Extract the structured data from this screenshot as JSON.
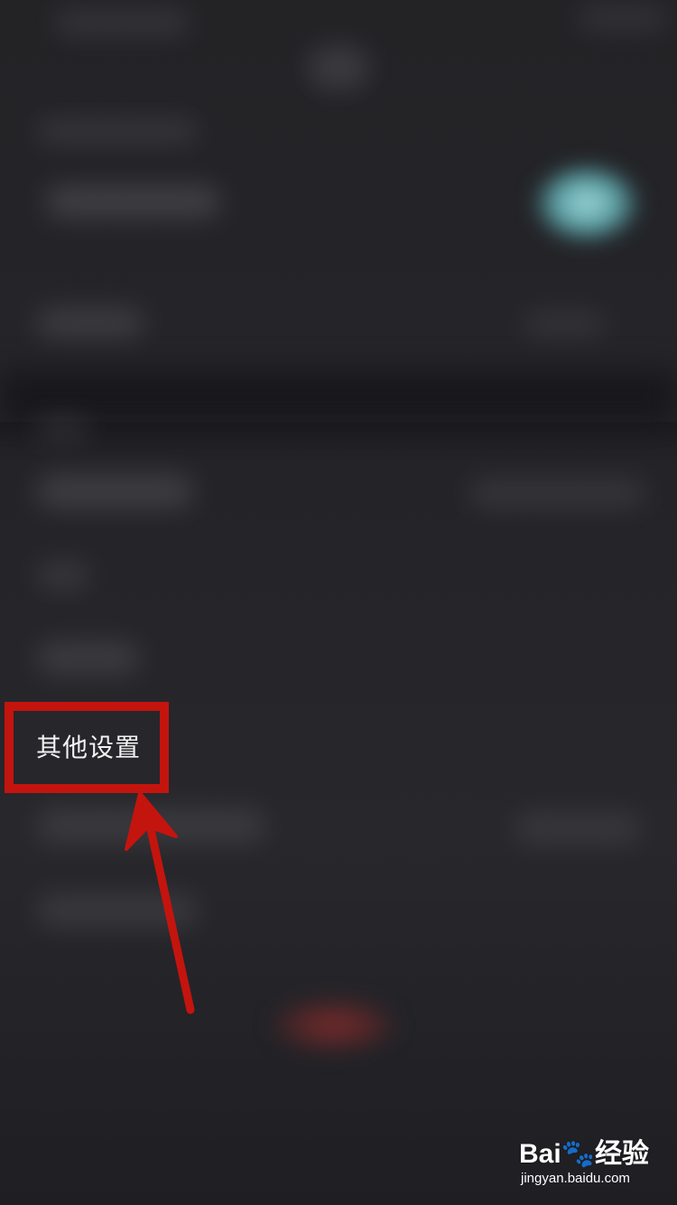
{
  "settings_list": {
    "highlighted_item_label": "其他设置"
  },
  "annotation": {
    "box_color": "#c4140e",
    "arrow_color": "#c4140e"
  },
  "watermark": {
    "logo_text": "Bai🐾经验",
    "url_text": "jingyan.baidu.com"
  },
  "colors": {
    "background": "#232326",
    "accent_glow": "#9fd6d8",
    "danger_glow": "#7a2c2c"
  }
}
